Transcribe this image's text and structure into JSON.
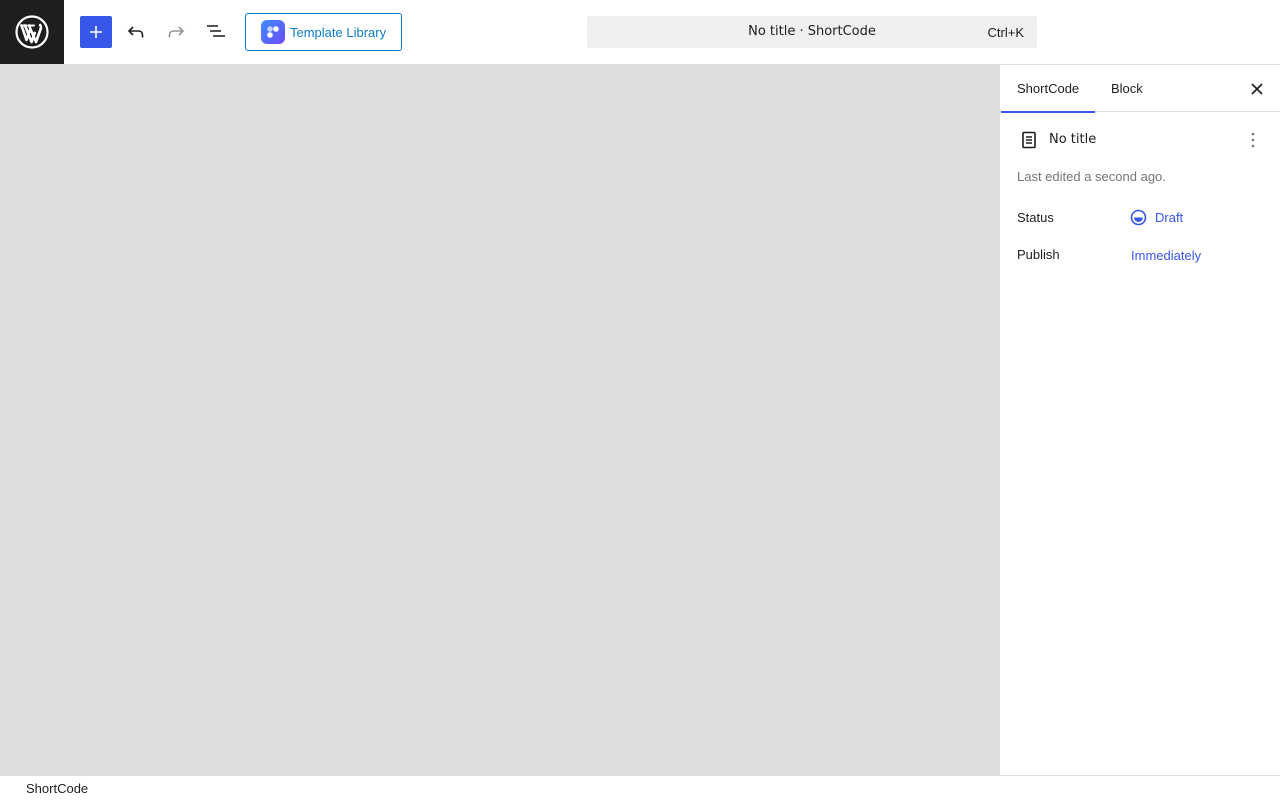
{
  "header": {
    "logo_icon": "wordpress-logo",
    "toolbar": {
      "inserter_icon": "plus-icon",
      "undo_icon": "undo-icon",
      "redo_icon": "redo-icon",
      "outline_icon": "document-overview-icon",
      "template_library_label": "Template Library"
    },
    "command_bar": {
      "title": "No title · ShortCode",
      "shortcut": "Ctrl+K"
    }
  },
  "sidebar": {
    "tabs": [
      {
        "label": "ShortCode",
        "active": true
      },
      {
        "label": "Block",
        "active": false
      }
    ],
    "close_icon": "close-icon",
    "document": {
      "title": "No title",
      "last_edited": "Last edited a second ago."
    },
    "properties": {
      "status_label": "Status",
      "status_value": "Draft",
      "publish_label": "Publish",
      "publish_value": "Immediately"
    }
  },
  "footer": {
    "breadcrumb": "ShortCode"
  },
  "colors": {
    "accent": "#3858e9",
    "canvas": "#dddddd",
    "template_library": "#0a7cc6",
    "logo_bg": "#1e1e1e"
  }
}
